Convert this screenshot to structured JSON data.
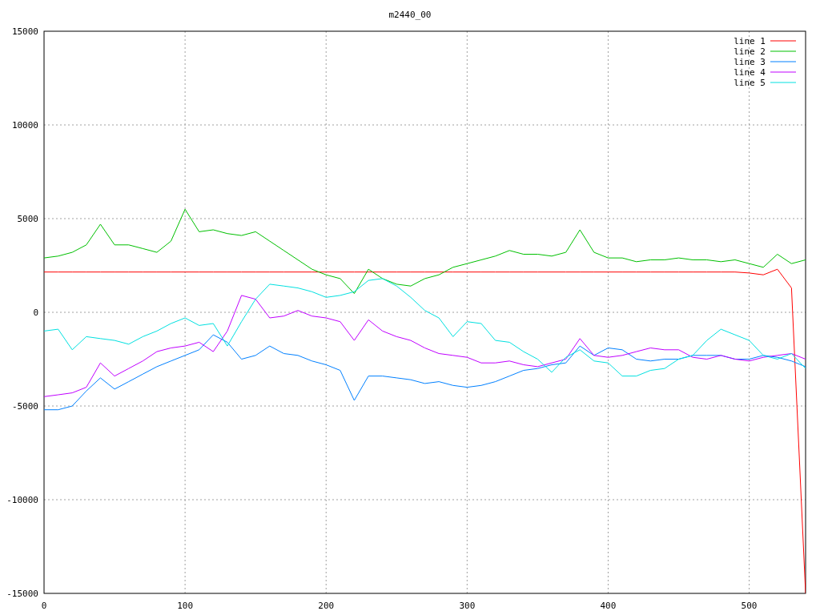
{
  "chart_data": {
    "type": "line",
    "title": "m2440_00",
    "x": [
      0,
      10,
      20,
      30,
      40,
      50,
      60,
      70,
      80,
      90,
      100,
      110,
      120,
      130,
      140,
      150,
      160,
      170,
      180,
      190,
      200,
      210,
      220,
      230,
      240,
      250,
      260,
      270,
      280,
      290,
      300,
      310,
      320,
      330,
      340,
      350,
      360,
      370,
      380,
      390,
      400,
      410,
      420,
      430,
      440,
      450,
      460,
      470,
      480,
      490,
      500,
      510,
      520,
      530,
      540
    ],
    "series": [
      {
        "name": "line 1",
        "color": "#ff0000",
        "values": [
          2150,
          2150,
          2150,
          2150,
          2150,
          2150,
          2150,
          2150,
          2150,
          2150,
          2150,
          2150,
          2150,
          2150,
          2150,
          2150,
          2150,
          2150,
          2150,
          2150,
          2150,
          2150,
          2150,
          2150,
          2150,
          2150,
          2150,
          2150,
          2150,
          2150,
          2150,
          2150,
          2150,
          2150,
          2150,
          2150,
          2150,
          2150,
          2150,
          2150,
          2150,
          2150,
          2150,
          2150,
          2150,
          2150,
          2150,
          2150,
          2150,
          2150,
          2100,
          2000,
          2300,
          1300,
          -15000
        ]
      },
      {
        "name": "line 2",
        "color": "#00c000",
        "values": [
          2900,
          3000,
          3200,
          3600,
          4700,
          3600,
          3600,
          3400,
          3200,
          3800,
          5500,
          4300,
          4400,
          4200,
          4100,
          4300,
          3800,
          3300,
          2800,
          2300,
          2000,
          1800,
          1000,
          2300,
          1800,
          1500,
          1400,
          1800,
          2000,
          2400,
          2600,
          2800,
          3000,
          3300,
          3100,
          3100,
          3000,
          3200,
          4400,
          3200,
          2900,
          2900,
          2700,
          2800,
          2800,
          2900,
          2800,
          2800,
          2700,
          2800,
          2600,
          2400,
          3100,
          2600,
          2800
        ]
      },
      {
        "name": "line 3",
        "color": "#0080ff",
        "values": [
          -5200,
          -5200,
          -5000,
          -4200,
          -3500,
          -4100,
          -3700,
          -3300,
          -2900,
          -2600,
          -2300,
          -2000,
          -1200,
          -1600,
          -2500,
          -2300,
          -1800,
          -2200,
          -2300,
          -2600,
          -2800,
          -3100,
          -4700,
          -3400,
          -3400,
          -3500,
          -3600,
          -3800,
          -3700,
          -3900,
          -4000,
          -3900,
          -3700,
          -3400,
          -3100,
          -3000,
          -2800,
          -2700,
          -1800,
          -2300,
          -1900,
          -2000,
          -2500,
          -2600,
          -2500,
          -2500,
          -2300,
          -2300,
          -2300,
          -2500,
          -2500,
          -2300,
          -2400,
          -2600,
          -2900
        ]
      },
      {
        "name": "line 4",
        "color": "#c000ff",
        "values": [
          -4500,
          -4400,
          -4300,
          -4000,
          -2700,
          -3400,
          -3000,
          -2600,
          -2100,
          -1900,
          -1800,
          -1600,
          -2100,
          -1000,
          900,
          700,
          -300,
          -200,
          100,
          -200,
          -300,
          -500,
          -1500,
          -400,
          -1000,
          -1300,
          -1500,
          -1900,
          -2200,
          -2300,
          -2400,
          -2700,
          -2700,
          -2600,
          -2800,
          -2900,
          -2700,
          -2500,
          -1400,
          -2300,
          -2400,
          -2300,
          -2100,
          -1900,
          -2000,
          -2000,
          -2400,
          -2500,
          -2300,
          -2500,
          -2600,
          -2400,
          -2300,
          -2200,
          -2500
        ]
      },
      {
        "name": "line 5",
        "color": "#00e0e0",
        "values": [
          -1000,
          -900,
          -2000,
          -1300,
          -1400,
          -1500,
          -1700,
          -1300,
          -1000,
          -600,
          -300,
          -700,
          -600,
          -1800,
          -500,
          700,
          1500,
          1400,
          1300,
          1100,
          800,
          900,
          1100,
          1700,
          1800,
          1400,
          800,
          100,
          -300,
          -1300,
          -500,
          -600,
          -1500,
          -1600,
          -2100,
          -2500,
          -3200,
          -2400,
          -2000,
          -2600,
          -2700,
          -3400,
          -3400,
          -3100,
          -3000,
          -2500,
          -2300,
          -1500,
          -900,
          -1200,
          -1500,
          -2300,
          -2500,
          -2200,
          -3000
        ]
      }
    ],
    "xlim": [
      0,
      540
    ],
    "ylim": [
      -15000,
      15000
    ],
    "xticks": [
      0,
      100,
      200,
      300,
      400,
      500
    ],
    "yticks": [
      -15000,
      -10000,
      -5000,
      0,
      5000,
      10000,
      15000
    ],
    "grid": true,
    "legend": true
  }
}
